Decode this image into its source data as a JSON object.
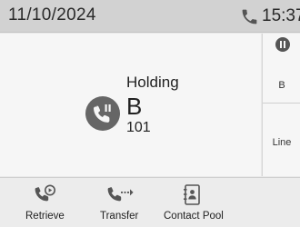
{
  "status_bar": {
    "date": "11/10/2024",
    "time": "15:37",
    "phone_icon": "phone-icon"
  },
  "call": {
    "status": "Holding",
    "name": "B",
    "number": "101",
    "icon": "call-hold-icon"
  },
  "line_keys": [
    {
      "label": "B",
      "icon": "pause-icon"
    },
    {
      "label": "Line"
    }
  ],
  "softkeys": [
    {
      "label": "Retrieve",
      "icon": "retrieve-call-icon"
    },
    {
      "label": "Transfer",
      "icon": "transfer-call-icon"
    },
    {
      "label": "Contact Pool",
      "icon": "contact-book-icon"
    }
  ],
  "colors": {
    "status_bar_bg": "#d2d2d2",
    "panel_bg": "#f6f6f6",
    "icon_dark": "#555555"
  }
}
